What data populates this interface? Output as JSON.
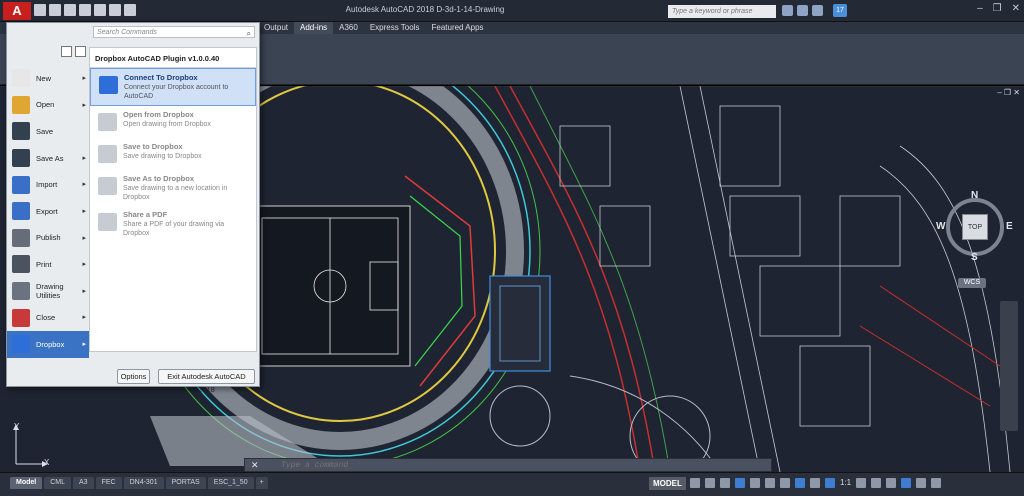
{
  "titlebar": {
    "app_letter": "A",
    "title": "Autodesk AutoCAD 2018   D-3d-1-14-Drawing",
    "search_placeholder": "Type a keyword or phrase",
    "signin_badge": "17"
  },
  "ribbon": {
    "tabs": [
      {
        "label": "Output"
      },
      {
        "label": "Add-ins"
      },
      {
        "label": "A360"
      },
      {
        "label": "Express Tools"
      },
      {
        "label": "Featured Apps"
      }
    ],
    "active_tab": "Add-ins"
  },
  "app_menu": {
    "search_placeholder": "Search Commands",
    "items": [
      {
        "label": "New",
        "icon": "new-icon",
        "color": "#e7e7e7",
        "arrow": true
      },
      {
        "label": "Open",
        "icon": "open-icon",
        "color": "#e0a634",
        "arrow": true
      },
      {
        "label": "Save",
        "icon": "save-icon",
        "color": "#33404f",
        "arrow": false
      },
      {
        "label": "Save As",
        "icon": "save-as-icon",
        "color": "#33404f",
        "arrow": true
      },
      {
        "label": "Import",
        "icon": "import-icon",
        "color": "#3a6fc7",
        "arrow": true
      },
      {
        "label": "Export",
        "icon": "export-icon",
        "color": "#3a6fc7",
        "arrow": true
      },
      {
        "label": "Publish",
        "icon": "publish-icon",
        "color": "#666d78",
        "arrow": true
      },
      {
        "label": "Print",
        "icon": "print-icon",
        "color": "#4b5260",
        "arrow": true
      },
      {
        "label": "Drawing Utilities",
        "icon": "utilities-icon",
        "color": "#6c7380",
        "arrow": true
      },
      {
        "label": "Close",
        "icon": "close-drawing-icon",
        "color": "#c83a3a",
        "arrow": true
      },
      {
        "label": "Dropbox",
        "icon": "dropbox-icon",
        "color": "#2d6ed9",
        "arrow": true
      }
    ],
    "panel_title": "Dropbox AutoCAD Plugin v1.0.0.40",
    "entries": [
      {
        "title": "Connect To Dropbox",
        "desc": "Connect your Dropbox account to AutoCAD",
        "icon": "dropbox-icon"
      },
      {
        "title": "Open from Dropbox",
        "desc": "Open drawing from Dropbox",
        "icon": "open-folder-icon"
      },
      {
        "title": "Save to Dropbox",
        "desc": "Save drawing to Dropbox",
        "icon": "save-icon"
      },
      {
        "title": "Save As to Dropbox",
        "desc": "Save drawing to a new location in Dropbox",
        "icon": "save-as-icon"
      },
      {
        "title": "Share a PDF",
        "desc": "Share a PDF of your drawing via Dropbox",
        "icon": "share-icon"
      }
    ],
    "options_label": "Options",
    "exit_label": "Exit Autodesk AutoCAD 2018"
  },
  "viewport": {
    "controls": "–  ❐  ✕",
    "viewcube": {
      "top": "TOP",
      "n": "N",
      "s": "S",
      "e": "E",
      "w": "W"
    },
    "wcs": "WCS",
    "ucs_y": "Y",
    "ucs_x": "X"
  },
  "command": {
    "placeholder": "Type a command",
    "close_glyph": "✕"
  },
  "statusbar": {
    "layouts": [
      "Model",
      "CML",
      "A3",
      "FEC",
      "DN4-301",
      "PORTAS",
      "ESC_1_50"
    ],
    "plus": "+",
    "model_label": "MODEL",
    "scale": "1:1"
  }
}
